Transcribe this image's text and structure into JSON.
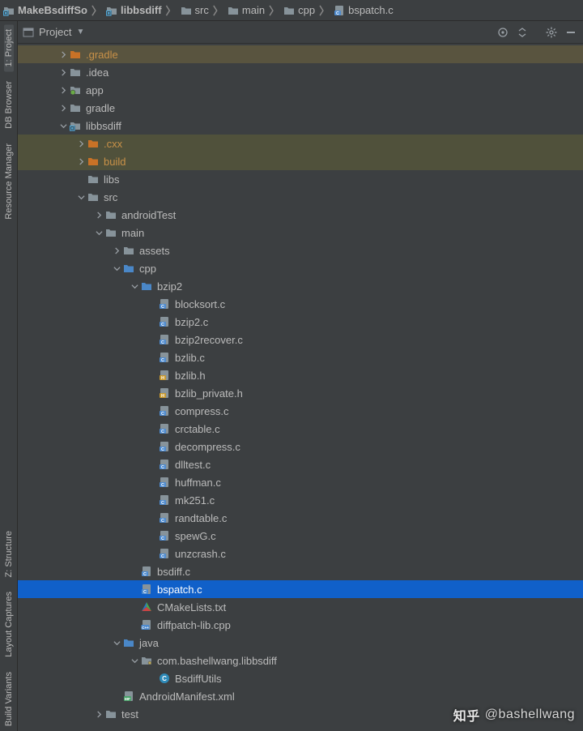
{
  "breadcrumbs": [
    {
      "icon": "module",
      "label": "MakeBsdiffSo"
    },
    {
      "icon": "module",
      "label": "libbsdiff"
    },
    {
      "icon": "folder",
      "label": "src"
    },
    {
      "icon": "folder",
      "label": "main"
    },
    {
      "icon": "folder",
      "label": "cpp"
    },
    {
      "icon": "cfile",
      "label": "bspatch.c"
    }
  ],
  "panel": {
    "title": "Project",
    "header_icons": [
      "target-icon",
      "collapse-icon",
      "gear-icon",
      "hide-icon"
    ]
  },
  "gutter": {
    "top": [
      {
        "label": "1: Project",
        "active": true
      },
      {
        "label": "DB Browser"
      },
      {
        "label": "Resource Manager"
      }
    ],
    "bottom": [
      {
        "label": "Z: Structure"
      },
      {
        "label": "Layout Captures"
      },
      {
        "label": "Build Variants"
      }
    ]
  },
  "watermark": {
    "logo": "知乎",
    "text": "@bashellwang"
  },
  "tree": [
    {
      "d": 0,
      "icon": "folder-orange",
      "label": ".gradle",
      "arrow": "right",
      "hl": "dark"
    },
    {
      "d": 0,
      "icon": "folder-grey",
      "label": ".idea",
      "arrow": "right"
    },
    {
      "d": 0,
      "icon": "module-green",
      "label": "app",
      "arrow": "right"
    },
    {
      "d": 0,
      "icon": "folder-grey",
      "label": "gradle",
      "arrow": "right"
    },
    {
      "d": 0,
      "icon": "module",
      "label": "libbsdiff",
      "arrow": "down"
    },
    {
      "d": 1,
      "icon": "folder-orange",
      "label": ".cxx",
      "arrow": "right",
      "hl": "deep"
    },
    {
      "d": 1,
      "icon": "folder-orange",
      "label": "build",
      "arrow": "right",
      "hl": "deep"
    },
    {
      "d": 1,
      "icon": "folder-grey",
      "label": "libs",
      "arrow": "none"
    },
    {
      "d": 1,
      "icon": "folder-grey",
      "label": "src",
      "arrow": "down"
    },
    {
      "d": 2,
      "icon": "folder-grey",
      "label": "androidTest",
      "arrow": "right"
    },
    {
      "d": 2,
      "icon": "folder-grey",
      "label": "main",
      "arrow": "down"
    },
    {
      "d": 3,
      "icon": "folder-grey",
      "label": "assets",
      "arrow": "right"
    },
    {
      "d": 3,
      "icon": "folder-blue",
      "label": "cpp",
      "arrow": "down"
    },
    {
      "d": 4,
      "icon": "folder-blue",
      "label": "bzip2",
      "arrow": "down"
    },
    {
      "d": 5,
      "icon": "cfile",
      "label": "blocksort.c"
    },
    {
      "d": 5,
      "icon": "cfile",
      "label": "bzip2.c"
    },
    {
      "d": 5,
      "icon": "cfile",
      "label": "bzip2recover.c"
    },
    {
      "d": 5,
      "icon": "cfile",
      "label": "bzlib.c"
    },
    {
      "d": 5,
      "icon": "hfile",
      "label": "bzlib.h"
    },
    {
      "d": 5,
      "icon": "hfile",
      "label": "bzlib_private.h"
    },
    {
      "d": 5,
      "icon": "cfile",
      "label": "compress.c"
    },
    {
      "d": 5,
      "icon": "cfile",
      "label": "crctable.c"
    },
    {
      "d": 5,
      "icon": "cfile",
      "label": "decompress.c"
    },
    {
      "d": 5,
      "icon": "cfile",
      "label": "dlltest.c"
    },
    {
      "d": 5,
      "icon": "cfile",
      "label": "huffman.c"
    },
    {
      "d": 5,
      "icon": "cfile",
      "label": "mk251.c"
    },
    {
      "d": 5,
      "icon": "cfile",
      "label": "randtable.c"
    },
    {
      "d": 5,
      "icon": "cfile",
      "label": "spewG.c"
    },
    {
      "d": 5,
      "icon": "cfile",
      "label": "unzcrash.c"
    },
    {
      "d": 4,
      "icon": "cfile",
      "label": "bsdiff.c"
    },
    {
      "d": 4,
      "icon": "cfile",
      "label": "bspatch.c",
      "selected": true
    },
    {
      "d": 4,
      "icon": "cmake",
      "label": "CMakeLists.txt"
    },
    {
      "d": 4,
      "icon": "cppfile",
      "label": "diffpatch-lib.cpp"
    },
    {
      "d": 3,
      "icon": "folder-blue",
      "label": "java",
      "arrow": "down"
    },
    {
      "d": 4,
      "icon": "package",
      "label": "com.bashellwang.libbsdiff",
      "arrow": "down"
    },
    {
      "d": 5,
      "icon": "class",
      "label": "BsdiffUtils"
    },
    {
      "d": 3,
      "icon": "manifest",
      "label": "AndroidManifest.xml"
    },
    {
      "d": 2,
      "icon": "folder-grey",
      "label": "test",
      "arrow": "right"
    }
  ]
}
